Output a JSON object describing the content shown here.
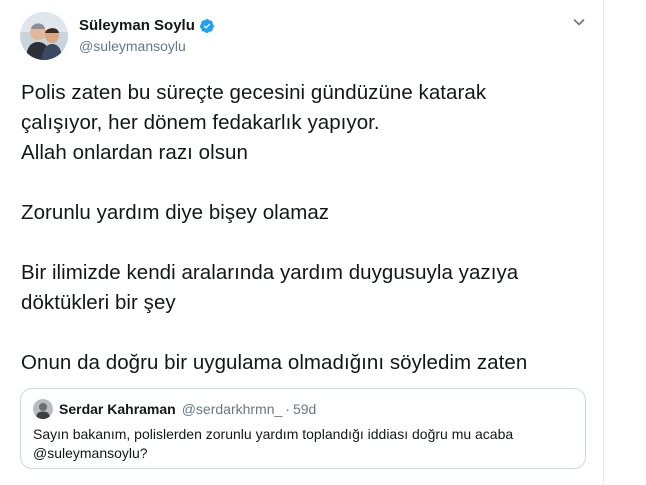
{
  "tweet": {
    "author": {
      "display_name": "Süleyman Soylu",
      "handle": "@suleymansoylu",
      "verified": true
    },
    "paragraphs": [
      "Polis zaten bu süreçte gecesini gündüzüne katarak\nçalışıyor, her dönem fedakarlık yapıyor.\nAllah onlardan razı olsun",
      "Zorunlu yardım diye bişey olamaz",
      "Bir ilimizde kendi aralarında yardım duygusuyla yazıya\ndöktükleri bir şey",
      "Onun da doğru bir uygulama olmadığını söyledim zaten"
    ],
    "quote": {
      "display_name": "Serdar Kahraman",
      "handle": "@serdarkhrmn_",
      "separator": "·",
      "time": "59d",
      "text": "Sayın bakanım, polislerden zorunlu yardım toplandığı iddiası doğru mu acaba\n@suleymansoylu?"
    }
  },
  "colors": {
    "text_primary": "#14171a",
    "text_secondary": "#657786",
    "verified_blue": "#1da1f2",
    "border": "#ccd6dd"
  },
  "icons": {
    "verified": "verified-badge-icon",
    "caret": "chevron-down-icon"
  }
}
